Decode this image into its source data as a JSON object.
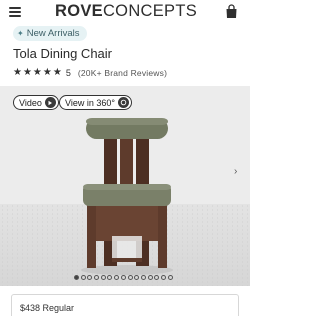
{
  "header": {
    "brand_bold": "ROVE",
    "brand_light": "CONCEPTS",
    "menu_icon": "hamburger-menu-icon",
    "bag_icon": "shopping-bag-icon"
  },
  "product": {
    "badge": "New Arrivals",
    "badge_icon": "sparkle-icon",
    "title": "Tola Dining Chair",
    "stars": "★★★★★",
    "rating": "5",
    "reviews": "(20K+ Brand Reviews)"
  },
  "media": {
    "video_label": "Video",
    "view360_label": "View in 360°",
    "next_icon": "chevron-right-icon",
    "slide_count": 15,
    "active_slide": 1
  },
  "pricing": {
    "regular": "$438 Regular"
  },
  "colors": {
    "badge_bg": "#e6f2f4",
    "seat_fabric": "#7a8069",
    "wood": "#5e3b2c",
    "image_bg": "#ececec"
  }
}
